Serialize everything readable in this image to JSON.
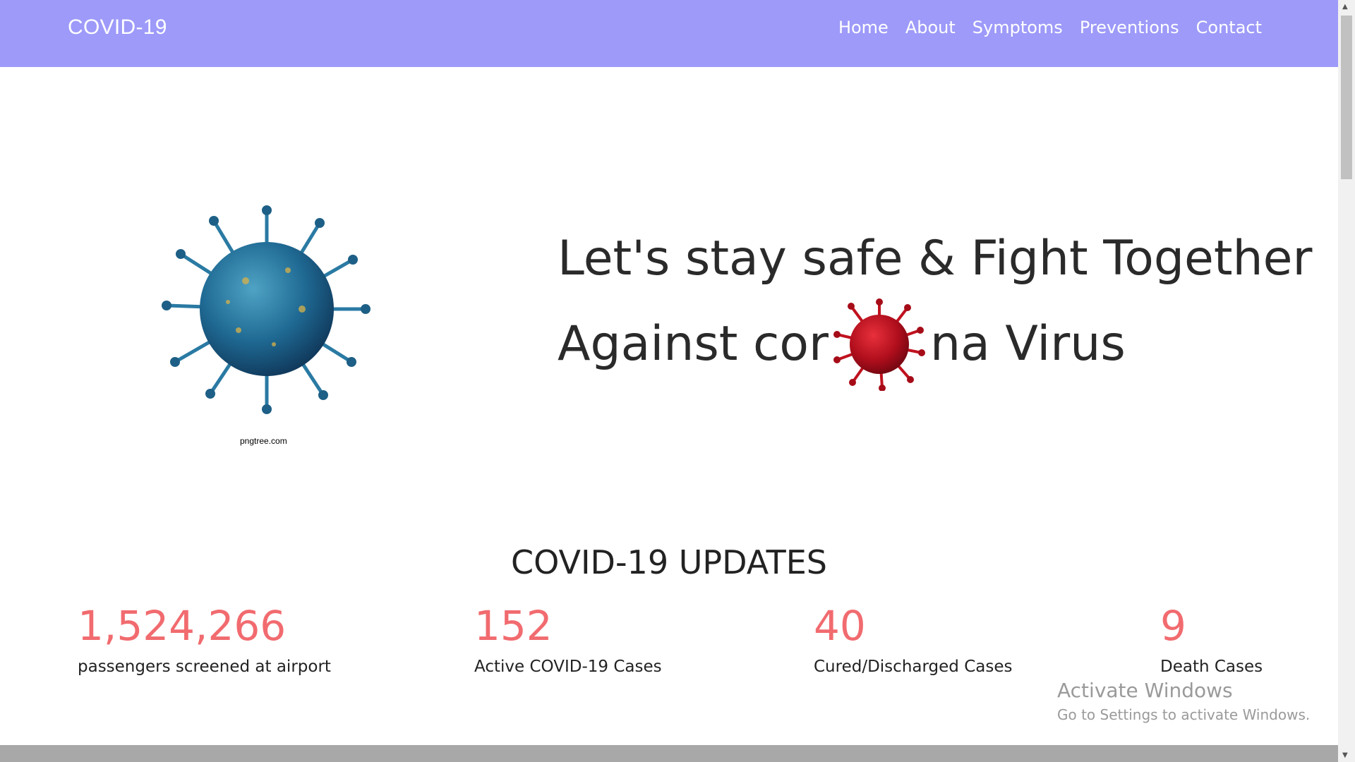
{
  "navbar": {
    "brand": "COVID-19",
    "links": [
      "Home",
      "About",
      "Symptoms",
      "Preventions",
      "Contact"
    ]
  },
  "hero": {
    "image_credit": "pngtree.com",
    "line1": "Let's stay safe & Fight Together",
    "line2_before": "Against cor",
    "line2_after": "na Virus"
  },
  "updates": {
    "title": "COVID-19 UPDATES",
    "stats": [
      {
        "value": "1,524,266",
        "label": "passengers screened at airport"
      },
      {
        "value": "152",
        "label": "Active COVID-19 Cases"
      },
      {
        "value": "40",
        "label": "Cured/Discharged Cases"
      },
      {
        "value": "9",
        "label": "Death Cases"
      }
    ]
  },
  "system_overlay": {
    "title": "Activate Windows",
    "subtitle": "Go to Settings to activate Windows."
  },
  "colors": {
    "navbar": "#9d9af9",
    "stat_value": "#f16b6f"
  }
}
